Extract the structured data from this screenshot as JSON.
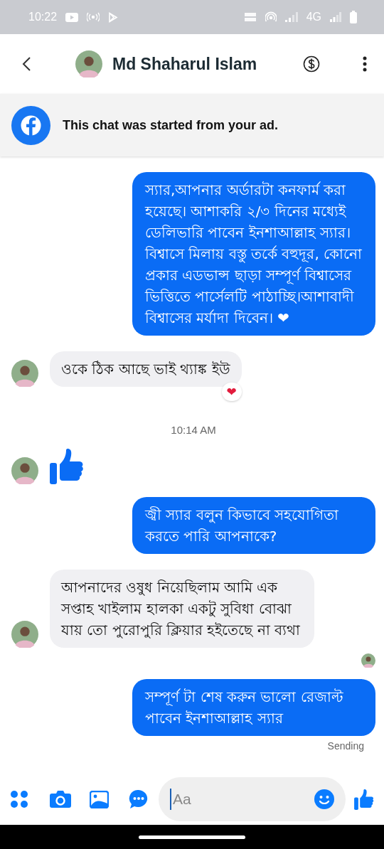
{
  "status_bar": {
    "time": "10:22",
    "network": "4G"
  },
  "header": {
    "contact_name": "Md Shaharul Islam"
  },
  "ad_banner": {
    "text": "This chat was started from your ad."
  },
  "messages": [
    {
      "kind": "outgoing",
      "text": "স্যার,আপনার অর্ডারটা কনফার্ম করা হয়েছে। আশাকরি ২/৩ দিনের মধ্যেই ডেলিভারি পাবেন ইনশাআল্লাহ স্যার। বিশ্বাসে মিলায় বস্তু তর্কে বহুদূর, কোনো প্রকার এডভান্স ছাড়া সম্পূর্ণ বিশ্বাসের ভিত্তিতে পার্সেলটি পাঠাচ্ছি।আশাবাদী বিশ্বাসের মর্যাদা দিবেন। ❤"
    },
    {
      "kind": "incoming",
      "text": "ওকে ঠিক আছে ভাই থ্যাঙ্ক ইউ",
      "reaction": "❤"
    },
    {
      "kind": "timestamp",
      "text": "10:14 AM"
    },
    {
      "kind": "incoming_like"
    },
    {
      "kind": "outgoing",
      "text": "জ্বী স্যার বলুন কিভাবে সহযোগিতা করতে পারি আপনাকে?"
    },
    {
      "kind": "incoming",
      "text": "আপনাদের ওষুধ নিয়েছিলাম আমি এক সপ্তাহ খাইলাম হালকা একটু সুবিধা বোঝা যায় তো পুরোপুরি ক্লিয়ার হইতেছে না ব্যথা"
    },
    {
      "kind": "read_receipt"
    },
    {
      "kind": "outgoing",
      "text": "সম্পূর্ণ টা শেষ করুন ভালো রেজাল্ট পাবেন ইনশাআল্লাহ স্যার"
    },
    {
      "kind": "status",
      "text": "Sending"
    }
  ],
  "composer": {
    "placeholder": "Aa"
  }
}
